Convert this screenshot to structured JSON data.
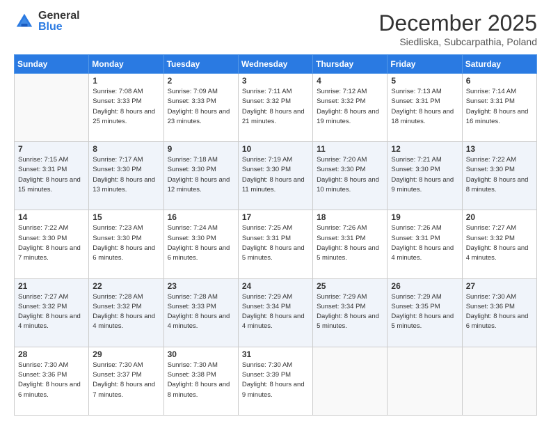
{
  "logo": {
    "general": "General",
    "blue": "Blue"
  },
  "header": {
    "month": "December 2025",
    "location": "Siedliska, Subcarpathia, Poland"
  },
  "weekdays": [
    "Sunday",
    "Monday",
    "Tuesday",
    "Wednesday",
    "Thursday",
    "Friday",
    "Saturday"
  ],
  "weeks": [
    [
      {
        "day": "",
        "sunrise": "",
        "sunset": "",
        "daylight": ""
      },
      {
        "day": "1",
        "sunrise": "Sunrise: 7:08 AM",
        "sunset": "Sunset: 3:33 PM",
        "daylight": "Daylight: 8 hours and 25 minutes."
      },
      {
        "day": "2",
        "sunrise": "Sunrise: 7:09 AM",
        "sunset": "Sunset: 3:33 PM",
        "daylight": "Daylight: 8 hours and 23 minutes."
      },
      {
        "day": "3",
        "sunrise": "Sunrise: 7:11 AM",
        "sunset": "Sunset: 3:32 PM",
        "daylight": "Daylight: 8 hours and 21 minutes."
      },
      {
        "day": "4",
        "sunrise": "Sunrise: 7:12 AM",
        "sunset": "Sunset: 3:32 PM",
        "daylight": "Daylight: 8 hours and 19 minutes."
      },
      {
        "day": "5",
        "sunrise": "Sunrise: 7:13 AM",
        "sunset": "Sunset: 3:31 PM",
        "daylight": "Daylight: 8 hours and 18 minutes."
      },
      {
        "day": "6",
        "sunrise": "Sunrise: 7:14 AM",
        "sunset": "Sunset: 3:31 PM",
        "daylight": "Daylight: 8 hours and 16 minutes."
      }
    ],
    [
      {
        "day": "7",
        "sunrise": "Sunrise: 7:15 AM",
        "sunset": "Sunset: 3:31 PM",
        "daylight": "Daylight: 8 hours and 15 minutes."
      },
      {
        "day": "8",
        "sunrise": "Sunrise: 7:17 AM",
        "sunset": "Sunset: 3:30 PM",
        "daylight": "Daylight: 8 hours and 13 minutes."
      },
      {
        "day": "9",
        "sunrise": "Sunrise: 7:18 AM",
        "sunset": "Sunset: 3:30 PM",
        "daylight": "Daylight: 8 hours and 12 minutes."
      },
      {
        "day": "10",
        "sunrise": "Sunrise: 7:19 AM",
        "sunset": "Sunset: 3:30 PM",
        "daylight": "Daylight: 8 hours and 11 minutes."
      },
      {
        "day": "11",
        "sunrise": "Sunrise: 7:20 AM",
        "sunset": "Sunset: 3:30 PM",
        "daylight": "Daylight: 8 hours and 10 minutes."
      },
      {
        "day": "12",
        "sunrise": "Sunrise: 7:21 AM",
        "sunset": "Sunset: 3:30 PM",
        "daylight": "Daylight: 8 hours and 9 minutes."
      },
      {
        "day": "13",
        "sunrise": "Sunrise: 7:22 AM",
        "sunset": "Sunset: 3:30 PM",
        "daylight": "Daylight: 8 hours and 8 minutes."
      }
    ],
    [
      {
        "day": "14",
        "sunrise": "Sunrise: 7:22 AM",
        "sunset": "Sunset: 3:30 PM",
        "daylight": "Daylight: 8 hours and 7 minutes."
      },
      {
        "day": "15",
        "sunrise": "Sunrise: 7:23 AM",
        "sunset": "Sunset: 3:30 PM",
        "daylight": "Daylight: 8 hours and 6 minutes."
      },
      {
        "day": "16",
        "sunrise": "Sunrise: 7:24 AM",
        "sunset": "Sunset: 3:30 PM",
        "daylight": "Daylight: 8 hours and 6 minutes."
      },
      {
        "day": "17",
        "sunrise": "Sunrise: 7:25 AM",
        "sunset": "Sunset: 3:31 PM",
        "daylight": "Daylight: 8 hours and 5 minutes."
      },
      {
        "day": "18",
        "sunrise": "Sunrise: 7:26 AM",
        "sunset": "Sunset: 3:31 PM",
        "daylight": "Daylight: 8 hours and 5 minutes."
      },
      {
        "day": "19",
        "sunrise": "Sunrise: 7:26 AM",
        "sunset": "Sunset: 3:31 PM",
        "daylight": "Daylight: 8 hours and 4 minutes."
      },
      {
        "day": "20",
        "sunrise": "Sunrise: 7:27 AM",
        "sunset": "Sunset: 3:32 PM",
        "daylight": "Daylight: 8 hours and 4 minutes."
      }
    ],
    [
      {
        "day": "21",
        "sunrise": "Sunrise: 7:27 AM",
        "sunset": "Sunset: 3:32 PM",
        "daylight": "Daylight: 8 hours and 4 minutes."
      },
      {
        "day": "22",
        "sunrise": "Sunrise: 7:28 AM",
        "sunset": "Sunset: 3:32 PM",
        "daylight": "Daylight: 8 hours and 4 minutes."
      },
      {
        "day": "23",
        "sunrise": "Sunrise: 7:28 AM",
        "sunset": "Sunset: 3:33 PM",
        "daylight": "Daylight: 8 hours and 4 minutes."
      },
      {
        "day": "24",
        "sunrise": "Sunrise: 7:29 AM",
        "sunset": "Sunset: 3:34 PM",
        "daylight": "Daylight: 8 hours and 4 minutes."
      },
      {
        "day": "25",
        "sunrise": "Sunrise: 7:29 AM",
        "sunset": "Sunset: 3:34 PM",
        "daylight": "Daylight: 8 hours and 5 minutes."
      },
      {
        "day": "26",
        "sunrise": "Sunrise: 7:29 AM",
        "sunset": "Sunset: 3:35 PM",
        "daylight": "Daylight: 8 hours and 5 minutes."
      },
      {
        "day": "27",
        "sunrise": "Sunrise: 7:30 AM",
        "sunset": "Sunset: 3:36 PM",
        "daylight": "Daylight: 8 hours and 6 minutes."
      }
    ],
    [
      {
        "day": "28",
        "sunrise": "Sunrise: 7:30 AM",
        "sunset": "Sunset: 3:36 PM",
        "daylight": "Daylight: 8 hours and 6 minutes."
      },
      {
        "day": "29",
        "sunrise": "Sunrise: 7:30 AM",
        "sunset": "Sunset: 3:37 PM",
        "daylight": "Daylight: 8 hours and 7 minutes."
      },
      {
        "day": "30",
        "sunrise": "Sunrise: 7:30 AM",
        "sunset": "Sunset: 3:38 PM",
        "daylight": "Daylight: 8 hours and 8 minutes."
      },
      {
        "day": "31",
        "sunrise": "Sunrise: 7:30 AM",
        "sunset": "Sunset: 3:39 PM",
        "daylight": "Daylight: 8 hours and 9 minutes."
      },
      {
        "day": "",
        "sunrise": "",
        "sunset": "",
        "daylight": ""
      },
      {
        "day": "",
        "sunrise": "",
        "sunset": "",
        "daylight": ""
      },
      {
        "day": "",
        "sunrise": "",
        "sunset": "",
        "daylight": ""
      }
    ]
  ]
}
